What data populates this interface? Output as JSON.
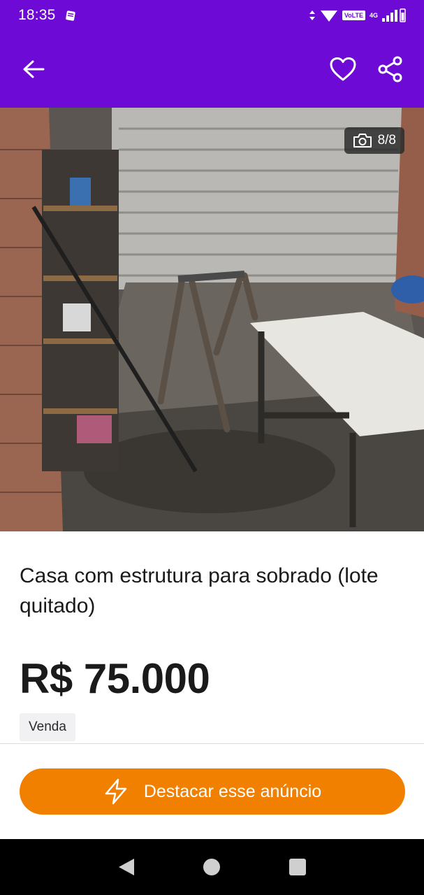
{
  "status_bar": {
    "time": "18:35",
    "volte": "VoLTE",
    "network": "4G"
  },
  "app_bar": {
    "back_icon": "arrow-left-icon",
    "favorite_icon": "heart-icon",
    "share_icon": "share-icon"
  },
  "photo": {
    "counter": "8/8",
    "counter_icon": "camera-icon"
  },
  "listing": {
    "title": "Casa com estrutura para sobrado (lote quitado)",
    "price": "R$ 75.000",
    "tag": "Venda"
  },
  "cta": {
    "label": "Destacar esse anúncio",
    "icon": "lightning-icon"
  },
  "colors": {
    "brand_purple": "#6E0AD6",
    "cta_orange": "#F28000"
  }
}
